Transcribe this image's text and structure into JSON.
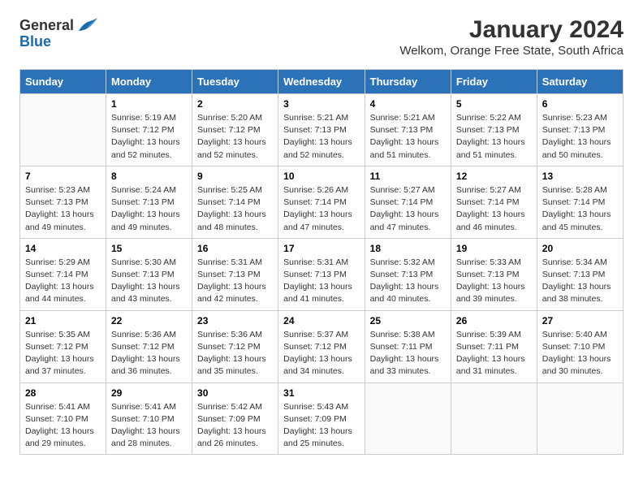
{
  "header": {
    "logo_general": "General",
    "logo_blue": "Blue",
    "title": "January 2024",
    "subtitle": "Welkom, Orange Free State, South Africa"
  },
  "days": [
    "Sunday",
    "Monday",
    "Tuesday",
    "Wednesday",
    "Thursday",
    "Friday",
    "Saturday"
  ],
  "weeks": [
    [
      {
        "date": "",
        "text": ""
      },
      {
        "date": "1",
        "text": "Sunrise: 5:19 AM\nSunset: 7:12 PM\nDaylight: 13 hours\nand 52 minutes."
      },
      {
        "date": "2",
        "text": "Sunrise: 5:20 AM\nSunset: 7:12 PM\nDaylight: 13 hours\nand 52 minutes."
      },
      {
        "date": "3",
        "text": "Sunrise: 5:21 AM\nSunset: 7:13 PM\nDaylight: 13 hours\nand 52 minutes."
      },
      {
        "date": "4",
        "text": "Sunrise: 5:21 AM\nSunset: 7:13 PM\nDaylight: 13 hours\nand 51 minutes."
      },
      {
        "date": "5",
        "text": "Sunrise: 5:22 AM\nSunset: 7:13 PM\nDaylight: 13 hours\nand 51 minutes."
      },
      {
        "date": "6",
        "text": "Sunrise: 5:23 AM\nSunset: 7:13 PM\nDaylight: 13 hours\nand 50 minutes."
      }
    ],
    [
      {
        "date": "7",
        "text": "Sunrise: 5:23 AM\nSunset: 7:13 PM\nDaylight: 13 hours\nand 49 minutes."
      },
      {
        "date": "8",
        "text": "Sunrise: 5:24 AM\nSunset: 7:13 PM\nDaylight: 13 hours\nand 49 minutes."
      },
      {
        "date": "9",
        "text": "Sunrise: 5:25 AM\nSunset: 7:14 PM\nDaylight: 13 hours\nand 48 minutes."
      },
      {
        "date": "10",
        "text": "Sunrise: 5:26 AM\nSunset: 7:14 PM\nDaylight: 13 hours\nand 47 minutes."
      },
      {
        "date": "11",
        "text": "Sunrise: 5:27 AM\nSunset: 7:14 PM\nDaylight: 13 hours\nand 47 minutes."
      },
      {
        "date": "12",
        "text": "Sunrise: 5:27 AM\nSunset: 7:14 PM\nDaylight: 13 hours\nand 46 minutes."
      },
      {
        "date": "13",
        "text": "Sunrise: 5:28 AM\nSunset: 7:14 PM\nDaylight: 13 hours\nand 45 minutes."
      }
    ],
    [
      {
        "date": "14",
        "text": "Sunrise: 5:29 AM\nSunset: 7:14 PM\nDaylight: 13 hours\nand 44 minutes."
      },
      {
        "date": "15",
        "text": "Sunrise: 5:30 AM\nSunset: 7:13 PM\nDaylight: 13 hours\nand 43 minutes."
      },
      {
        "date": "16",
        "text": "Sunrise: 5:31 AM\nSunset: 7:13 PM\nDaylight: 13 hours\nand 42 minutes."
      },
      {
        "date": "17",
        "text": "Sunrise: 5:31 AM\nSunset: 7:13 PM\nDaylight: 13 hours\nand 41 minutes."
      },
      {
        "date": "18",
        "text": "Sunrise: 5:32 AM\nSunset: 7:13 PM\nDaylight: 13 hours\nand 40 minutes."
      },
      {
        "date": "19",
        "text": "Sunrise: 5:33 AM\nSunset: 7:13 PM\nDaylight: 13 hours\nand 39 minutes."
      },
      {
        "date": "20",
        "text": "Sunrise: 5:34 AM\nSunset: 7:13 PM\nDaylight: 13 hours\nand 38 minutes."
      }
    ],
    [
      {
        "date": "21",
        "text": "Sunrise: 5:35 AM\nSunset: 7:12 PM\nDaylight: 13 hours\nand 37 minutes."
      },
      {
        "date": "22",
        "text": "Sunrise: 5:36 AM\nSunset: 7:12 PM\nDaylight: 13 hours\nand 36 minutes."
      },
      {
        "date": "23",
        "text": "Sunrise: 5:36 AM\nSunset: 7:12 PM\nDaylight: 13 hours\nand 35 minutes."
      },
      {
        "date": "24",
        "text": "Sunrise: 5:37 AM\nSunset: 7:12 PM\nDaylight: 13 hours\nand 34 minutes."
      },
      {
        "date": "25",
        "text": "Sunrise: 5:38 AM\nSunset: 7:11 PM\nDaylight: 13 hours\nand 33 minutes."
      },
      {
        "date": "26",
        "text": "Sunrise: 5:39 AM\nSunset: 7:11 PM\nDaylight: 13 hours\nand 31 minutes."
      },
      {
        "date": "27",
        "text": "Sunrise: 5:40 AM\nSunset: 7:10 PM\nDaylight: 13 hours\nand 30 minutes."
      }
    ],
    [
      {
        "date": "28",
        "text": "Sunrise: 5:41 AM\nSunset: 7:10 PM\nDaylight: 13 hours\nand 29 minutes."
      },
      {
        "date": "29",
        "text": "Sunrise: 5:41 AM\nSunset: 7:10 PM\nDaylight: 13 hours\nand 28 minutes."
      },
      {
        "date": "30",
        "text": "Sunrise: 5:42 AM\nSunset: 7:09 PM\nDaylight: 13 hours\nand 26 minutes."
      },
      {
        "date": "31",
        "text": "Sunrise: 5:43 AM\nSunset: 7:09 PM\nDaylight: 13 hours\nand 25 minutes."
      },
      {
        "date": "",
        "text": ""
      },
      {
        "date": "",
        "text": ""
      },
      {
        "date": "",
        "text": ""
      }
    ]
  ]
}
